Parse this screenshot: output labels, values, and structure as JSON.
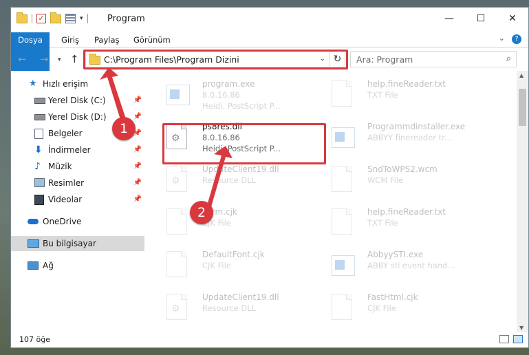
{
  "window": {
    "title": "Program",
    "min": "—",
    "max": "☐",
    "close": "✕"
  },
  "ribbon": {
    "tabs": [
      "Dosya",
      "Giriş",
      "Paylaş",
      "Görünüm"
    ],
    "help": "?"
  },
  "address": {
    "path": "C:\\Program Files\\Program Dizini"
  },
  "search": {
    "placeholder": "Ara: Program"
  },
  "sidebar": {
    "items": [
      {
        "label": "Hızlı erişim",
        "icon": "star-icon",
        "pinned": false
      },
      {
        "label": "Yerel Disk (C:)",
        "icon": "drive-icon",
        "pinned": true
      },
      {
        "label": "Yerel Disk (D:)",
        "icon": "drive-icon",
        "pinned": true
      },
      {
        "label": "Belgeler",
        "icon": "documents-icon",
        "pinned": true
      },
      {
        "label": "İndirmeler",
        "icon": "download-icon",
        "pinned": true
      },
      {
        "label": "Müzik",
        "icon": "music-icon",
        "pinned": true
      },
      {
        "label": "Resimler",
        "icon": "pictures-icon",
        "pinned": true
      },
      {
        "label": "Videolar",
        "icon": "video-icon",
        "pinned": true
      },
      {
        "label": "OneDrive",
        "icon": "cloud-icon",
        "pinned": false
      },
      {
        "label": "Bu bilgisayar",
        "icon": "computer-icon",
        "pinned": false
      },
      {
        "label": "Ağ",
        "icon": "network-icon",
        "pinned": false
      }
    ]
  },
  "files": [
    {
      "name": "program.exe",
      "line2": "8.0.16.86",
      "line3": "Heidi. PostScript P...",
      "icon": "exe-icon"
    },
    {
      "name": "help.fineReader.txt",
      "line2": "TXT File",
      "line3": "",
      "icon": "text-file-icon"
    },
    {
      "name": "ps8res.dll",
      "line2": "8.0.16.86",
      "line3": "Heidi. PostScript P...",
      "icon": "dll-icon"
    },
    {
      "name": "Programmdinstaller.exe",
      "line2": "ABBYY finereader tr...",
      "line3": "",
      "icon": "exe-icon"
    },
    {
      "name": "UpdateClient19.dll",
      "line2": "Resource DLL",
      "line3": "",
      "icon": "dll-icon"
    },
    {
      "name": "SndToWPS2.wcm",
      "line2": "WCM File",
      "line3": "",
      "icon": "file-icon"
    },
    {
      "name": "Form.cjk",
      "line2": "CJK File",
      "line3": "",
      "icon": "file-icon"
    },
    {
      "name": "help.fineReader.txt",
      "line2": "TXT File",
      "line3": "",
      "icon": "text-file-icon"
    },
    {
      "name": "DefaultFont.cjk",
      "line2": "CJK File",
      "line3": "",
      "icon": "file-icon"
    },
    {
      "name": "AbbyySTI.exe",
      "line2": "ABBY sti event hand...",
      "line3": "",
      "icon": "exe-icon"
    },
    {
      "name": "UpdateClient19.dll",
      "line2": "Resource DLL",
      "line3": "",
      "icon": "dll-icon"
    },
    {
      "name": "FastHtml.cjk",
      "line2": "CJK File",
      "line3": "",
      "icon": "file-icon"
    }
  ],
  "status": {
    "count": "107 öğe"
  },
  "callouts": [
    "1",
    "2"
  ],
  "colors": {
    "accent": "#1979ca",
    "highlight": "#d9393e",
    "selected": "#d9d9d9"
  }
}
